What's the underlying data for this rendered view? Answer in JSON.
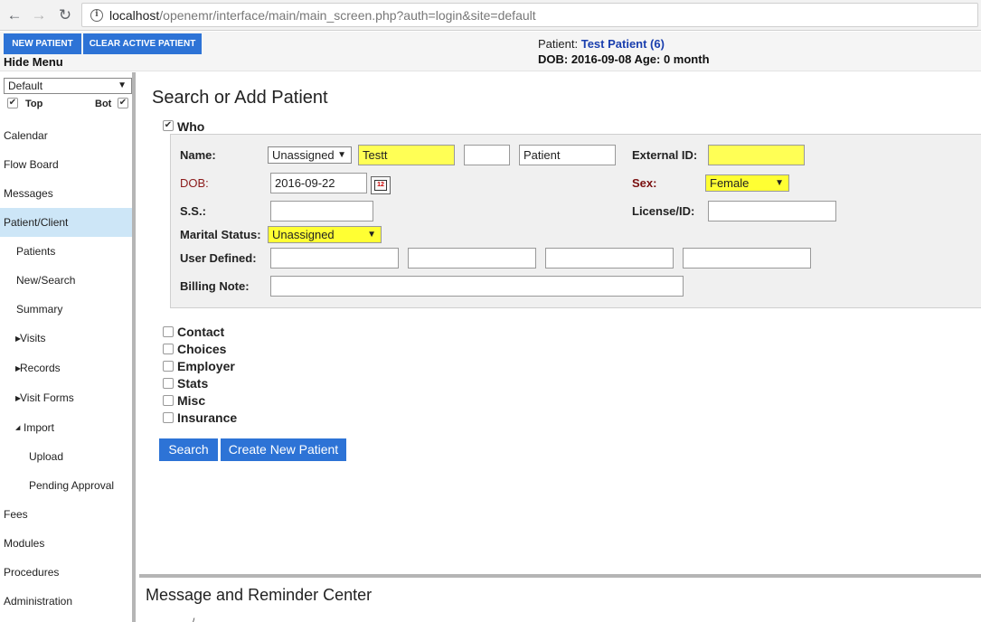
{
  "browser": {
    "url_host": "localhost",
    "url_path": "/openemr/interface/main/main_screen.php?auth=login&site=default"
  },
  "header": {
    "new_patient_label": "NEW PATIENT",
    "clear_patient_label": "CLEAR ACTIVE PATIENT",
    "hide_menu_label": "Hide Menu",
    "patient_prefix": "Patient:",
    "patient_name": "Test Patient (6)",
    "dob_line": "DOB: 2016-09-08 Age: 0 month"
  },
  "sidebar": {
    "layout_select": "Default",
    "top_label": "Top",
    "top_checked": true,
    "bot_label": "Bot",
    "bot_checked": true,
    "items": [
      {
        "label": "Calendar"
      },
      {
        "label": "Flow Board"
      },
      {
        "label": "Messages"
      },
      {
        "label": "Patient/Client",
        "active": true
      },
      {
        "label": "Patients"
      },
      {
        "label": "New/Search"
      },
      {
        "label": "Summary"
      },
      {
        "label": "Visits"
      },
      {
        "label": "Records"
      },
      {
        "label": "Visit Forms"
      },
      {
        "label": "Import"
      },
      {
        "label": "Upload"
      },
      {
        "label": "Pending Approval"
      },
      {
        "label": "Fees"
      },
      {
        "label": "Modules"
      },
      {
        "label": "Procedures"
      },
      {
        "label": "Administration"
      }
    ]
  },
  "form": {
    "title": "Search or Add Patient",
    "who_label": "Who",
    "who_checked": true,
    "name_label": "Name:",
    "title_select": "Unassigned",
    "first_name": "Testt",
    "middle_name": "",
    "last_name": "Patient",
    "external_id_label": "External ID:",
    "external_id": "",
    "dob_label": "DOB:",
    "dob_value": "2016-09-22",
    "sex_label": "Sex:",
    "sex_select": "Female",
    "ss_label": "S.S.:",
    "ss_value": "",
    "license_label": "License/ID:",
    "license_value": "",
    "marital_label": "Marital Status:",
    "marital_select": "Unassigned",
    "user_defined_label": "User Defined:",
    "billing_note_label": "Billing Note:",
    "sections": [
      "Contact",
      "Choices",
      "Employer",
      "Stats",
      "Misc",
      "Insurance"
    ],
    "search_button": "Search",
    "create_button": "Create New Patient"
  },
  "bottom": {
    "title": "Message and Reminder Center"
  },
  "colors": {
    "accent_blue": "#2d73d6",
    "required_yellow": "#ffff55",
    "active_menu": "#cde6f7"
  }
}
